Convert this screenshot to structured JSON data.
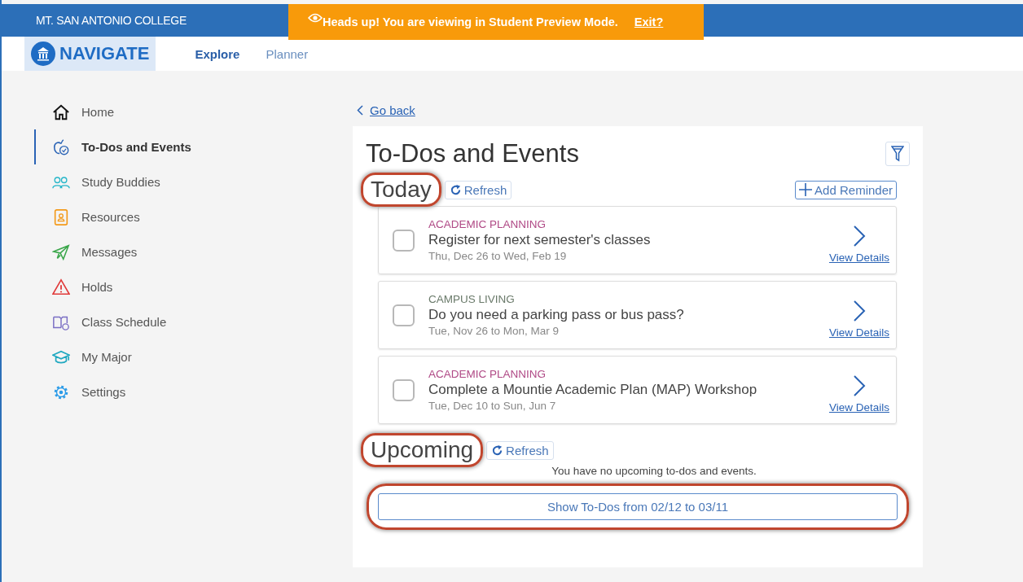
{
  "header": {
    "college": "MT. SAN ANTONIO COLLEGE",
    "logo": "NAVIGATE",
    "nav": [
      {
        "label": "Explore",
        "selected": true
      },
      {
        "label": "Planner",
        "selected": false
      }
    ]
  },
  "banner": {
    "message": "Heads up! You are viewing in Student Preview Mode.",
    "link": "Exit?"
  },
  "sidebar": {
    "items": [
      {
        "label": "Home",
        "kind": "home",
        "selected": false
      },
      {
        "label": "To-Dos and Events",
        "kind": "apple",
        "selected": true
      },
      {
        "label": "Study Buddies",
        "kind": "people",
        "selected": false
      },
      {
        "label": "Resources",
        "kind": "book",
        "selected": false
      },
      {
        "label": "Messages",
        "kind": "plane",
        "selected": false
      },
      {
        "label": "Holds",
        "kind": "warning",
        "selected": false
      },
      {
        "label": "Class Schedule",
        "kind": "schedule",
        "selected": false
      },
      {
        "label": "My Major",
        "kind": "cap",
        "selected": false
      },
      {
        "label": "Settings",
        "kind": "gear",
        "selected": false
      }
    ]
  },
  "back_link": "Go back",
  "page_title": "To-Dos and Events",
  "today": {
    "heading": "Today",
    "highlighted": true,
    "refresh": "Refresh",
    "add_reminder": "Add Reminder",
    "items": [
      {
        "category": "ACADEMIC PLANNING",
        "color": "#b04a86",
        "title": "Register for next semester's classes",
        "dates": "Thu, Dec 26 to Wed, Feb 19",
        "checked": false,
        "link": "View Details"
      },
      {
        "category": "CAMPUS LIVING",
        "color": "#6a7a6a",
        "title": "Do you need a parking pass or bus pass?",
        "dates": "Tue, Nov 26 to Mon, Mar 9",
        "checked": false,
        "link": "View Details"
      },
      {
        "category": "ACADEMIC PLANNING",
        "color": "#b04a86",
        "title": "Complete a Mountie Academic Plan (MAP) Workshop",
        "dates": "Tue, Dec 10 to Sun, Jun 7",
        "checked": false,
        "link": "View Details"
      }
    ]
  },
  "upcoming": {
    "heading": "Upcoming",
    "highlighted": true,
    "refresh": "Refresh",
    "empty_message": "You have no upcoming to-dos and events.",
    "show_button": "Show To-Dos from 02/12 to 03/11",
    "show_button_highlighted": true
  }
}
